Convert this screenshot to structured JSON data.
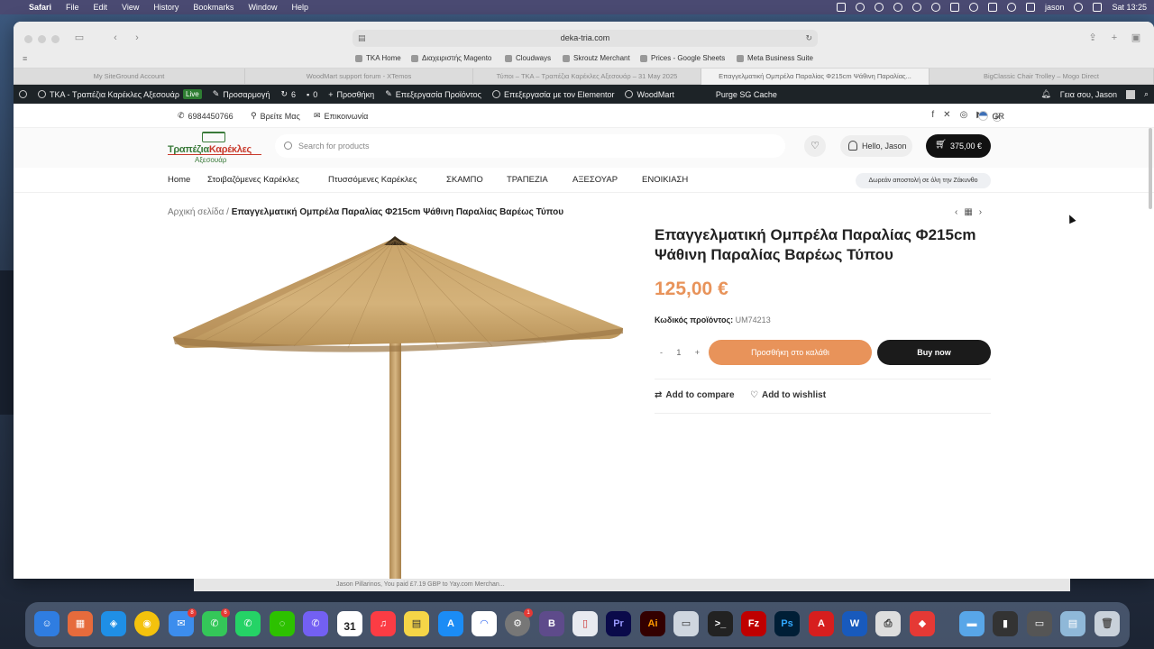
{
  "menubar": {
    "app": "Safari",
    "items": [
      "File",
      "Edit",
      "View",
      "History",
      "Bookmarks",
      "Window",
      "Help"
    ],
    "user": "jason",
    "clock": "Sat 13:25"
  },
  "browser": {
    "url": "deka-tria.com",
    "favorites": [
      "TKA Home",
      "Διαχειριστής Magento",
      "Cloudways",
      "Skroutz Merchant",
      "Prices - Google Sheets",
      "Meta Business Suite"
    ],
    "tabs": [
      "My SiteGround Account",
      "WoodMart support forum - XTemos",
      "Τύποι – TKA – Τραπέζια Καρέκλες Αξεσουάρ – 31 May 2025",
      "Επαγγελματική Ομπρέλα Παραλίας Φ215cm Ψάθινη Παραλίας...",
      "BigClassic Chair Trolley – Mogo Direct"
    ]
  },
  "adminbar": {
    "site": "TKA - Τραπέζια Καρέκλες Αξεσουάρ",
    "live": "Live",
    "customize": "Προσαρμογή",
    "updates": "6",
    "comments": "0",
    "new": "Προσθήκη",
    "edit_product": "Επεξεργασία Προϊόντος",
    "elementor": "Επεξεργασία με τον Elementor",
    "woodmart": "WoodMart",
    "purge": "Purge SG Cache",
    "greeting": "Γεια σου, Jason"
  },
  "topbar": {
    "phone": "6984450766",
    "find_us": "Βρείτε Μας",
    "contact": "Επικοινωνία",
    "lang": "GR"
  },
  "header": {
    "logo_main_a": "Τραπέζια",
    "logo_main_b": "Καρέκλες",
    "logo_sub": "Αξεσουάρ",
    "search_placeholder": "Search for products",
    "account": "Hello, Jason",
    "cart_total": "375,00 €"
  },
  "nav": {
    "items": [
      "Home",
      "Στοιβαζόμενες Καρέκλες",
      "Πτυσσόμενες Καρέκλες",
      "ΣΚΑΜΠΟ",
      "ΤΡΑΠΕΖΙΑ",
      "ΑΞΕΣΟΥΑΡ",
      "ΕΝΟΙΚΙΑΣΗ"
    ],
    "promo": "Δωρεάν αποστολή σε όλη την Ζάκυνθο"
  },
  "product": {
    "breadcrumb_home": "Αρχική σελίδα",
    "breadcrumb_sep": "/",
    "breadcrumb_current": "Επαγγελματική Ομπρέλα Παραλίας Φ215cm Ψάθινη Παραλίας Βαρέως Τύπου",
    "title": "Επαγγελματική Ομπρέλα Παραλίας Φ215cm Ψάθινη Παραλίας Βαρέως Τύπου",
    "price": "125,00 €",
    "sku_label": "Κωδικός προϊόντος:",
    "sku_value": "UM74213",
    "quantity": "1",
    "add_to_cart": "Προσθήκη στο καλάθι",
    "buy_now": "Buy now",
    "compare": "Add to compare",
    "wishlist": "Add to wishlist"
  },
  "notification": {
    "text": "Jason Pillarinos, You paid £7.19 GBP to Yay.com Merchan..."
  },
  "dock": {
    "badges": {
      "mail": "8",
      "messages": "6",
      "settings": "1"
    },
    "calendar_day": "31",
    "calendar_month": "MAY"
  }
}
